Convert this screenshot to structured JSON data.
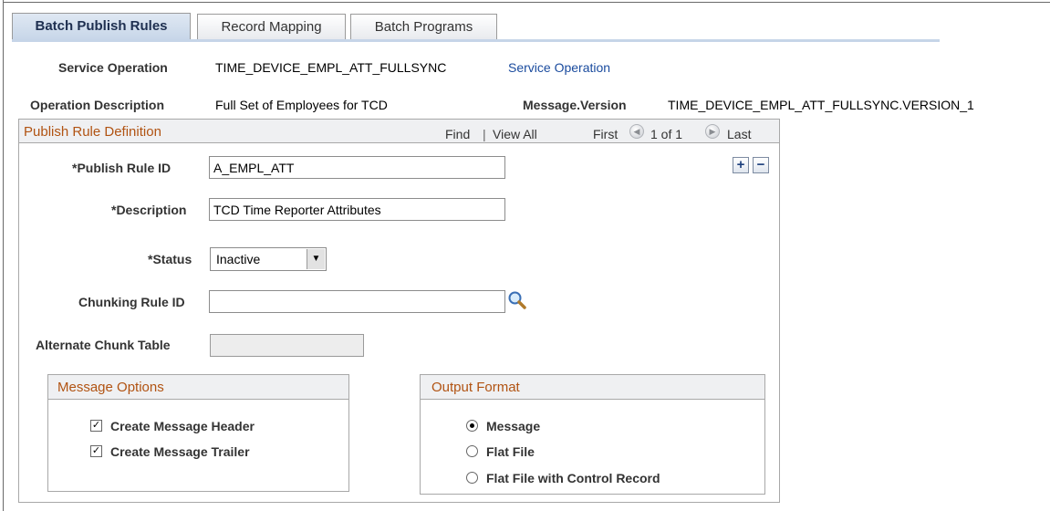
{
  "tabs": [
    {
      "label": "Batch Publish Rules",
      "active": true
    },
    {
      "label": "Record Mapping",
      "active": false
    },
    {
      "label": "Batch Programs",
      "active": false
    }
  ],
  "header": {
    "service_operation_label": "Service Operation",
    "service_operation_value": "TIME_DEVICE_EMPL_ATT_FULLSYNC",
    "service_operation_link": "Service Operation",
    "operation_description_label": "Operation Description",
    "operation_description_value": "Full Set of Employees for TCD",
    "message_version_label": "Message.Version",
    "message_version_value": "TIME_DEVICE_EMPL_ATT_FULLSYNC.VERSION_1"
  },
  "publish_rule": {
    "title": "Publish Rule Definition",
    "nav": {
      "find": "Find",
      "separator": "|",
      "view_all": "View All",
      "first": "First",
      "count": "1 of 1",
      "last": "Last"
    },
    "fields": {
      "publish_rule_id_label": "*Publish Rule ID",
      "publish_rule_id_value": "A_EMPL_ATT",
      "description_label": "*Description",
      "description_value": "TCD Time Reporter Attributes",
      "status_label": "*Status",
      "status_value": "Inactive",
      "chunking_rule_label": "Chunking Rule ID",
      "chunking_rule_value": "",
      "alternate_chunk_label": "Alternate Chunk Table",
      "alternate_chunk_value": ""
    },
    "message_options": {
      "title": "Message Options",
      "items": [
        {
          "label": "Create Message Header",
          "checked": true
        },
        {
          "label": "Create Message Trailer",
          "checked": true
        }
      ]
    },
    "output_format": {
      "title": "Output Format",
      "items": [
        {
          "label": "Message",
          "selected": true
        },
        {
          "label": "Flat File",
          "selected": false
        },
        {
          "label": "Flat File with Control Record",
          "selected": false
        }
      ]
    }
  },
  "colors": {
    "section_title": "#b15312",
    "link": "#1a4b9e",
    "active_tab": "#c6d5e8"
  },
  "icons": {
    "add": "plus-icon",
    "delete": "minus-icon",
    "lookup": "magnifier-icon",
    "prev": "arrow-left-icon",
    "next": "arrow-right-icon"
  }
}
